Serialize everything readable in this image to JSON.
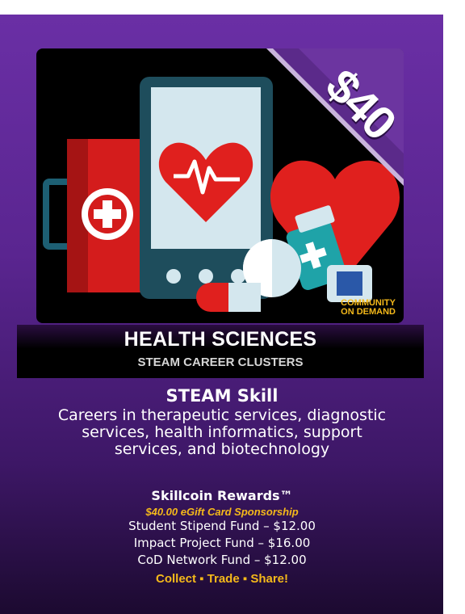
{
  "card": {
    "price": "$40",
    "logo_line1": "COMMUNITY",
    "logo_line2": "ON DEMAND",
    "title": "HEALTH SCIENCES",
    "subtitle": "STEAM CAREER CLUSTERS",
    "skill_title": "STEAM Skill",
    "skill_description": "Careers in therapeutic services, diagnostic services, health informatics, support services, and biotechnology",
    "rewards_title": "Skillcoin Rewards™",
    "sponsorship": "$40.00 eGift Card Sponsorship",
    "funds": [
      "Student Stipend Fund – $12.00",
      "Impact Project Fund – $16.00",
      "CoD Network Fund – $12.00"
    ],
    "cta": "Collect ▪ Trade ▪ Share!"
  },
  "icons": [
    "first-aid-kit-icon",
    "tablet-heart-icon",
    "heart-icon",
    "pill-bottle-icon",
    "capsule-icon"
  ],
  "colors": {
    "purple_top": "#6a2fa5",
    "purple_bottom": "#1c0a30",
    "accent_gold": "#f5b91a",
    "medical_red": "#e0201e"
  }
}
